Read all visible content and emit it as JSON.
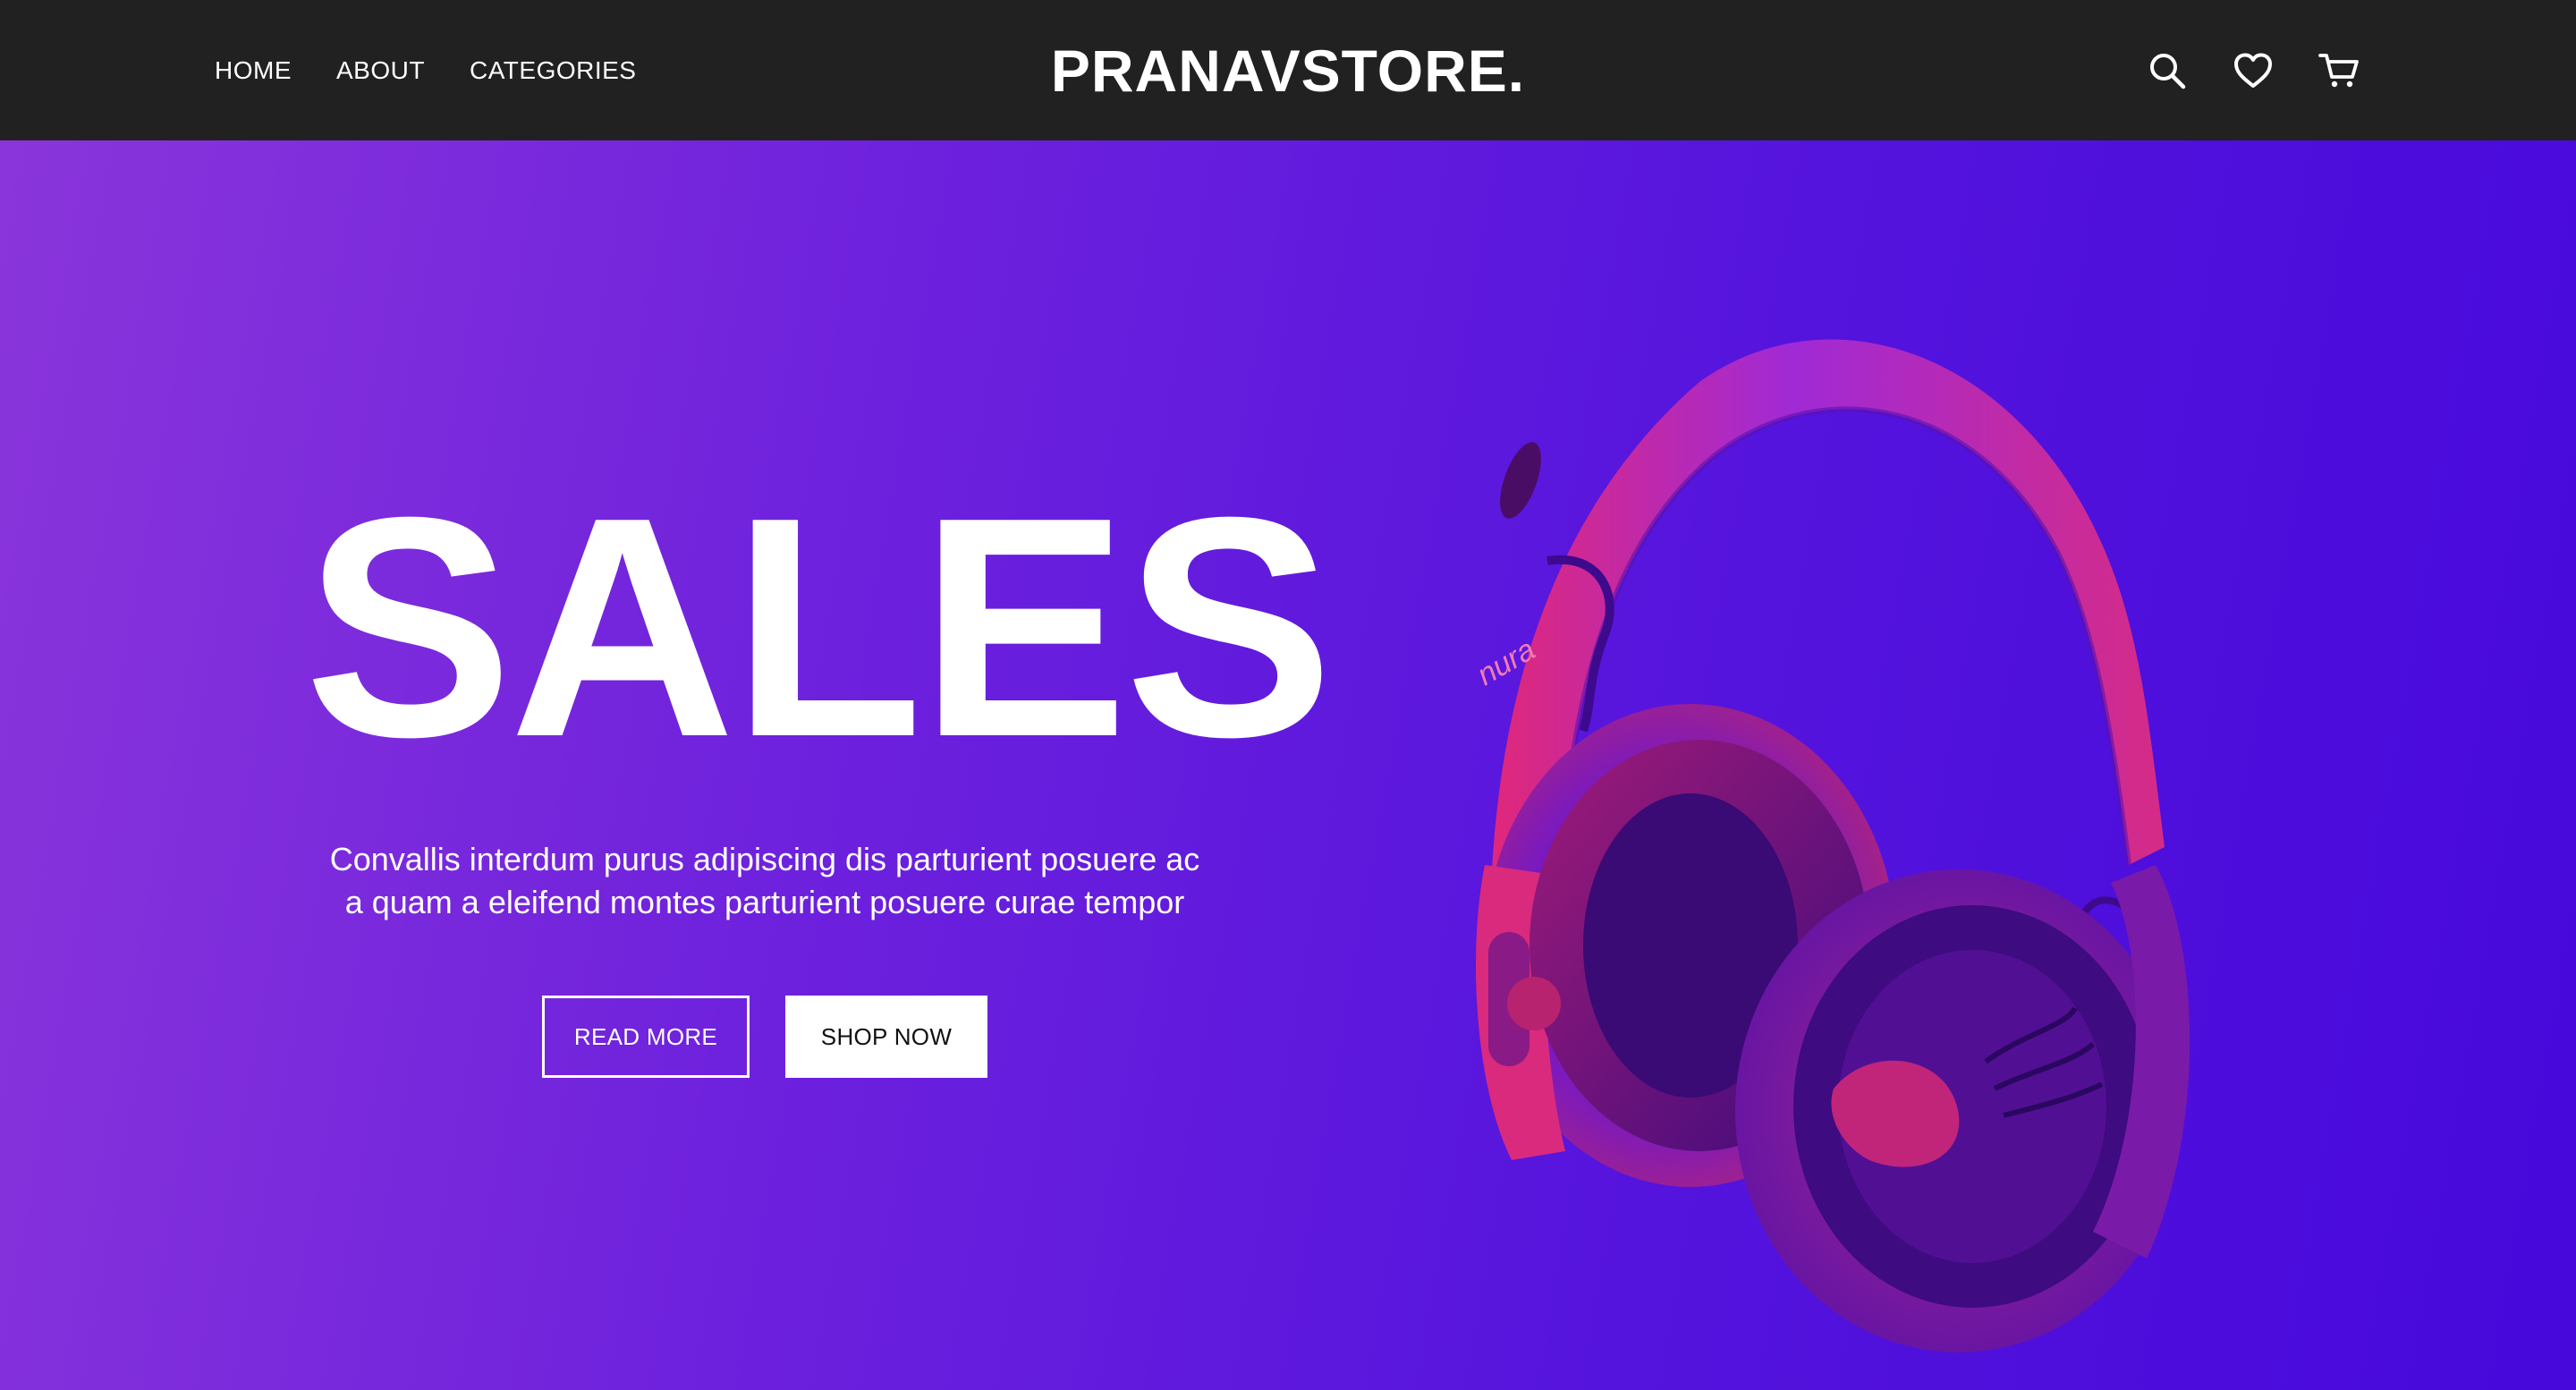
{
  "nav": {
    "links": [
      "HOME",
      "ABOUT",
      "CATEGORIES"
    ],
    "brand": "PRANAVSTORE.",
    "icons": [
      "search-icon",
      "heart-icon",
      "cart-icon"
    ]
  },
  "hero": {
    "title": "SALES",
    "description": "Convallis interdum purus adipiscing dis parturient posuere ac a quam a eleifend montes parturient posuere curae tempor",
    "buttons": {
      "read_more": "READ MORE",
      "shop_now": "SHOP NOW"
    },
    "image_label": "nura"
  },
  "colors": {
    "navbar": "#212121",
    "hero_gradient_start": "#8a35db",
    "hero_gradient_end": "#4608db",
    "headphone_accent": "#e0287a",
    "text": "#ffffff"
  }
}
